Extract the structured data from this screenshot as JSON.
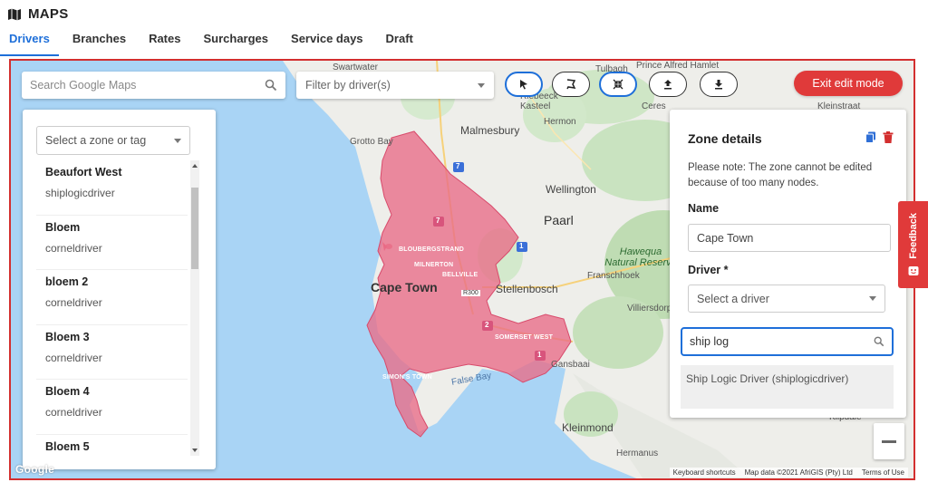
{
  "app": {
    "title": "MAPS",
    "icon": "map-icon"
  },
  "tabs": [
    {
      "label": "Drivers",
      "active": true
    },
    {
      "label": "Branches",
      "active": false
    },
    {
      "label": "Rates",
      "active": false
    },
    {
      "label": "Surcharges",
      "active": false
    },
    {
      "label": "Service days",
      "active": false
    },
    {
      "label": "Draft",
      "active": false
    }
  ],
  "toolbar": {
    "search_placeholder": "Search Google Maps",
    "filter_placeholder": "Filter by driver(s)",
    "tools": [
      {
        "icon": "pointer-icon",
        "active": true
      },
      {
        "icon": "flag-polygon-icon",
        "active": false
      },
      {
        "icon": "collapse-arrows-icon",
        "active": true
      },
      {
        "icon": "upload-icon",
        "active": false
      },
      {
        "icon": "download-icon",
        "active": false
      }
    ],
    "exit_label": "Exit edit mode"
  },
  "zone_list": {
    "select_placeholder": "Select a zone or tag",
    "items": [
      {
        "name": "Beaufort West",
        "driver": "shiplogicdriver"
      },
      {
        "name": "Bloem",
        "driver": "corneldriver"
      },
      {
        "name": "bloem 2",
        "driver": "corneldriver"
      },
      {
        "name": "Bloem 3",
        "driver": "corneldriver"
      },
      {
        "name": "Bloem 4",
        "driver": "corneldriver"
      },
      {
        "name": "Bloem 5",
        "driver": ""
      }
    ]
  },
  "zone_details": {
    "title": "Zone details",
    "note": "Please note: The zone cannot be edited because of too many nodes.",
    "name_label": "Name",
    "name_value": "Cape Town",
    "driver_label": "Driver *",
    "driver_placeholder": "Select a driver",
    "dropdown_search_value": "ship log",
    "dropdown_option": "Ship Logic Driver (shiplogicdriver)"
  },
  "map": {
    "zone_color": "#e96b86",
    "labels": {
      "swartwater": "Swartwater",
      "tulbagh": "Tulbagh",
      "prince_alfred_hamlet": "Prince Alfred Hamlet",
      "riebeeck_kasteel": "Riebeeck Kasteel",
      "hermon": "Hermon",
      "ceres": "Ceres",
      "kleinstraat": "Kleinstraat",
      "grotto_bay": "Grotto Bay",
      "malmesbury": "Malmesbury",
      "wellington": "Wellington",
      "paarl": "Paarl",
      "hawequa": "Hawequa Natural Reserve",
      "franschhoek": "Franschhoek",
      "bloubergstrand": "BLOUBERGSTRAND",
      "milnerton": "MILNERTON",
      "bellville": "BELLVILLE",
      "cape_town": "Cape Town",
      "stellenbosch": "Stellenbosch",
      "villiersdorp": "Villiersdorp",
      "somerset_west": "SOMERSET WEST",
      "simons_town": "SIMON'S TOWN",
      "false_bay": "False Bay",
      "gansbaai": "Gansbaai",
      "kleinmond": "Kleinmond",
      "kilpdale": "Kilpdale",
      "hermanus": "Hermanus",
      "r300": "R300"
    },
    "route_shields": {
      "n7": "7",
      "n2": "2",
      "m7": "7",
      "n1_a": "1",
      "n1_b": "1"
    },
    "attribution": {
      "google": "Google",
      "keyboard": "Keyboard shortcuts",
      "data": "Map data ©2021 AfriGIS (Pty) Ltd",
      "terms": "Terms of Use"
    }
  },
  "feedback_label": "Feedback"
}
